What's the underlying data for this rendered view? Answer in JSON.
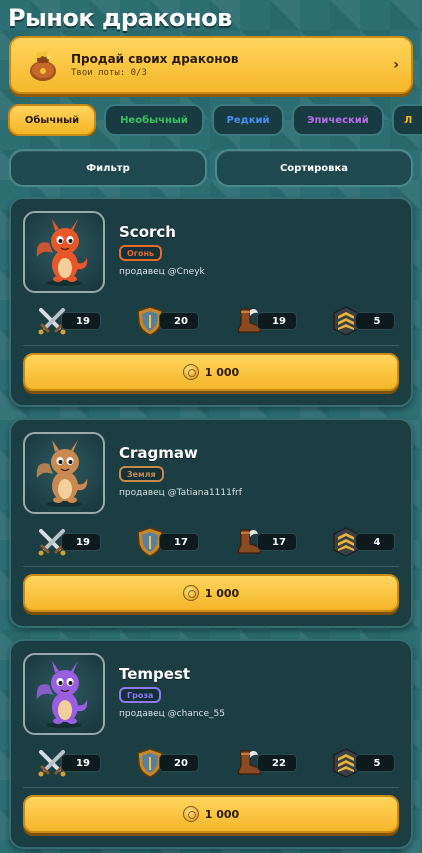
{
  "page": {
    "title": "Рынок драконов"
  },
  "sell_banner": {
    "title": "Продай своих драконов",
    "subtitle": "Твои лоты: 0/3",
    "chevron": "›",
    "icon": "treasure-bag-icon"
  },
  "rarity_tabs": [
    {
      "label": "Обычный",
      "color": "#2b1b05",
      "active": true
    },
    {
      "label": "Необычный",
      "color": "#3dbf61",
      "active": false
    },
    {
      "label": "Редкий",
      "color": "#4a8df0",
      "active": false
    },
    {
      "label": "Эпический",
      "color": "#b46be8",
      "active": false
    },
    {
      "label": "Л",
      "color": "#f0b42a",
      "active": false
    }
  ],
  "controls": {
    "filter_label": "Фильтр",
    "sort_label": "Сортировка"
  },
  "listings": [
    {
      "name": "Scorch",
      "element": "Огонь",
      "element_color": "#e86a2a",
      "dragon_color": "#e8572a",
      "seller": "продавец @Cneyk",
      "stats": {
        "attack": "19",
        "defense": "20",
        "speed": "19",
        "rank": "5"
      },
      "price": "1 000"
    },
    {
      "name": "Cragmaw",
      "element": "Земля",
      "element_color": "#c48a4a",
      "dragon_color": "#c98a52",
      "seller": "продавец @Tatiana1111frf",
      "stats": {
        "attack": "19",
        "defense": "17",
        "speed": "17",
        "rank": "4"
      },
      "price": "1 000"
    },
    {
      "name": "Tempest",
      "element": "Гроза",
      "element_color": "#8a7cf0",
      "dragon_color": "#9b5ee0",
      "seller": "продавец @chance_55",
      "stats": {
        "attack": "19",
        "defense": "20",
        "speed": "22",
        "rank": "5"
      },
      "price": "1 000"
    }
  ],
  "icons": {
    "attack": "crossed-swords-icon",
    "defense": "shield-icon",
    "speed": "boot-icon",
    "rank": "chevron-rank-icon",
    "coin": "coin-icon"
  }
}
